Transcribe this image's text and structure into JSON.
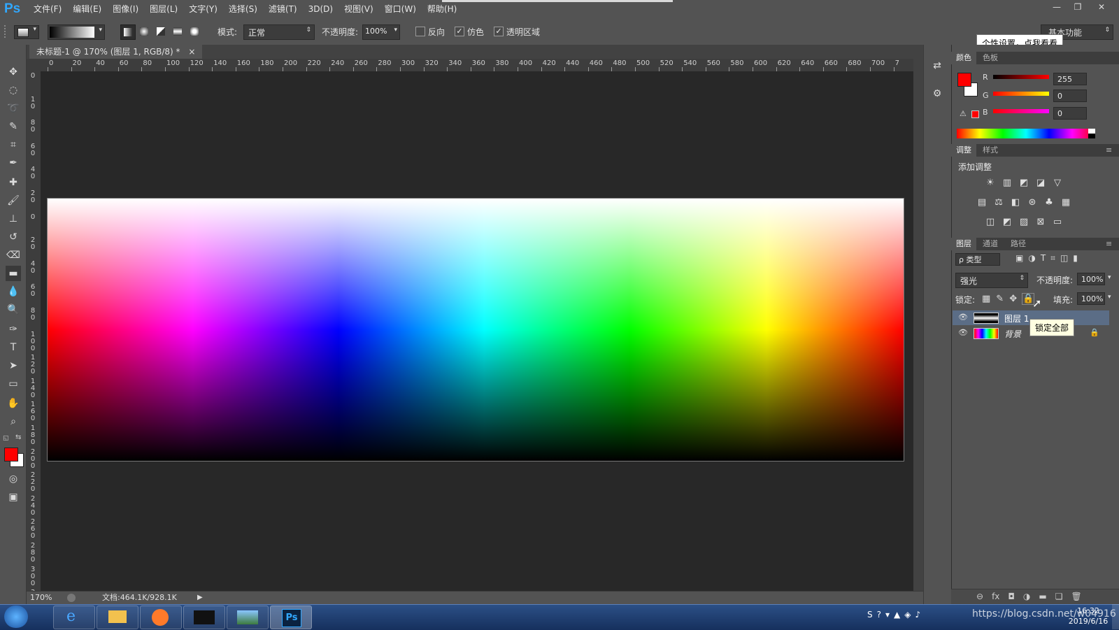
{
  "app": {
    "logo": "Ps",
    "menu": [
      "文件(F)",
      "编辑(E)",
      "图像(I)",
      "图层(L)",
      "文字(Y)",
      "选择(S)",
      "滤镜(T)",
      "3D(D)",
      "视图(V)",
      "窗口(W)",
      "帮助(H)"
    ],
    "window_buttons": [
      "—",
      "❐",
      "✕"
    ]
  },
  "options": {
    "mode_label": "模式:",
    "mode_value": "正常",
    "opacity_label": "不透明度:",
    "opacity_value": "100%",
    "reverse_label": "反向",
    "dither_label": "仿色",
    "transparency_label": "透明区域",
    "reverse_checked": false,
    "dither_checked": true,
    "transparency_checked": true,
    "workspace_label": "基本功能"
  },
  "popup": {
    "personalize_tip": "个性设置，点我看看",
    "lock_all_tip": "锁定全部"
  },
  "document": {
    "tab_title": "未标题-1 @ 170% (图层 1, RGB/8) *",
    "tab_close": "×",
    "ruler_h": [
      "0",
      "20",
      "40",
      "60",
      "80",
      "100",
      "120",
      "140",
      "160",
      "180",
      "200",
      "220",
      "240",
      "260",
      "280",
      "300",
      "320",
      "340",
      "360",
      "380",
      "400",
      "420",
      "440",
      "460",
      "480",
      "500",
      "520",
      "540",
      "560",
      "580",
      "600",
      "620",
      "640",
      "660",
      "680",
      "700",
      "7"
    ],
    "ruler_v": [
      "0",
      "1 0",
      "8 0",
      "6 0",
      "4 0",
      "2 0",
      "0",
      "2 0",
      "4 0",
      "6 0",
      "8 0",
      "1 0 0",
      "1 2 0",
      "1 4 0",
      "1 6 0",
      "1 8 0",
      "2 0 0",
      "2 2 0",
      "2 4 0",
      "2 6 0",
      "2 8 0",
      "3 0 0",
      "3"
    ]
  },
  "status": {
    "zoom": "170%",
    "doc_size": "文档:464.1K/928.1K"
  },
  "color_panel": {
    "tabs": [
      "颜色",
      "色板"
    ],
    "r_label": "R",
    "g_label": "G",
    "b_label": "B",
    "r_value": "255",
    "g_value": "0",
    "b_value": "0",
    "foreground": "#ff0000",
    "background": "#ffffff"
  },
  "adjust_panel": {
    "tabs": [
      "调整",
      "样式"
    ],
    "title": "添加调整",
    "row1": [
      "☀",
      "▥",
      "◩",
      "◪",
      "▽"
    ],
    "row2": [
      "▤",
      "⚖",
      "◧",
      "⊛",
      "♣",
      "▦"
    ],
    "row3": [
      "◫",
      "◩",
      "▨",
      "⊠",
      "▭"
    ]
  },
  "layers_panel": {
    "tabs": [
      "图层",
      "通道",
      "路径"
    ],
    "filter_label": "ρ 类型",
    "blend_mode": "强光",
    "opacity_label": "不透明度:",
    "opacity_value": "100%",
    "lock_label": "锁定:",
    "fill_label": "填充:",
    "fill_value": "100%",
    "layers": [
      {
        "name": "图层 1",
        "selected": true
      },
      {
        "name": "背景",
        "selected": false,
        "locked": true
      }
    ],
    "footer_icons": [
      "⊖",
      "fx",
      "◘",
      "◑",
      "▬",
      "❏",
      "🗑"
    ]
  },
  "taskbar": {
    "clock_time": "16:32",
    "clock_date": "2019/6/16",
    "watermark": "https://blog.csdn.net/w04916"
  },
  "colors": {
    "ui_bg": "#535353",
    "pasteboard": "#282828",
    "ps_blue": "#31a8ff",
    "taskbar": "#16305d"
  }
}
